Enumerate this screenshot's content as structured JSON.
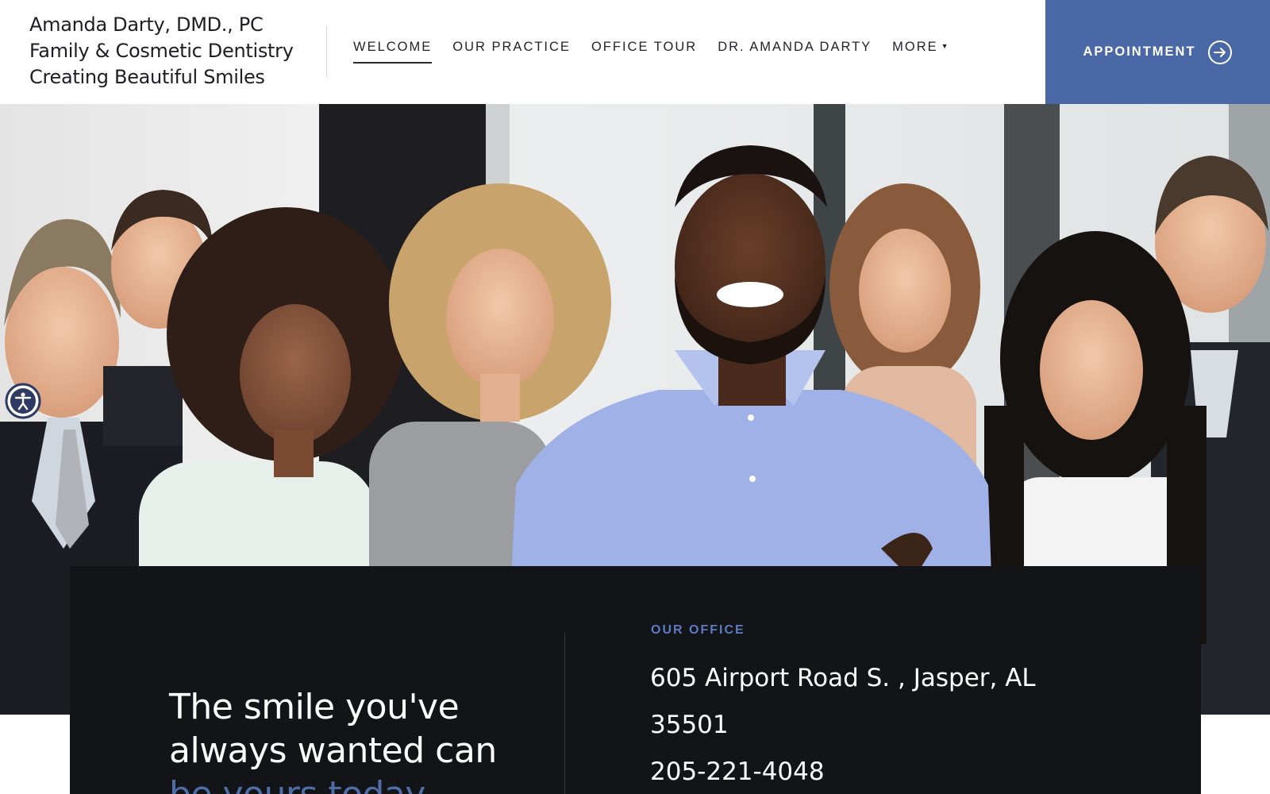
{
  "brand": {
    "line1": "Amanda Darty, DMD., PC",
    "line2": "Family & Cosmetic Dentistry",
    "line3": "Creating Beautiful Smiles"
  },
  "nav": {
    "items": [
      {
        "label": "WELCOME",
        "active": true
      },
      {
        "label": "OUR PRACTICE",
        "active": false
      },
      {
        "label": "OFFICE TOUR",
        "active": false
      },
      {
        "label": "DR. AMANDA DARTY",
        "active": false
      },
      {
        "label": "MORE",
        "active": false,
        "has_dropdown": true
      }
    ]
  },
  "appointment": {
    "label": "APPOINTMENT",
    "icon": "arrow-circle-right-icon"
  },
  "hero": {
    "image": "group-of-smiling-professionals-photo"
  },
  "accessibility": {
    "icon": "accessibility-icon"
  },
  "panel": {
    "tagline_line1": "The smile you've",
    "tagline_line2": "always wanted can",
    "tagline_line3": "be yours today",
    "office_label": "OUR OFFICE",
    "address_line1": "605 Airport Road S. , Jasper, AL",
    "address_line2": "35501",
    "phone": "205-221-4048"
  },
  "colors": {
    "accent": "#4a68a5",
    "accent_text": "#5b7cc0",
    "panel_bg": "#131418",
    "header_bg": "#ffffff"
  }
}
